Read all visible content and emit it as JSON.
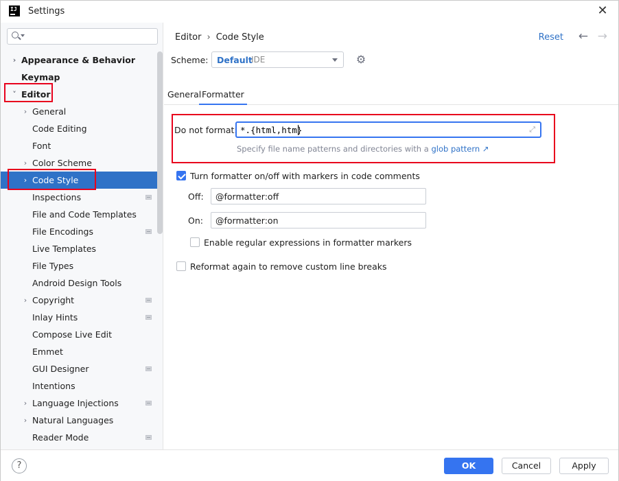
{
  "window": {
    "title": "Settings",
    "app_icon_text": "IJ"
  },
  "sidebar": {
    "search_placeholder": "",
    "items": [
      {
        "label": "Appearance & Behavior",
        "arrow": "›",
        "bold": true
      },
      {
        "label": "Keymap",
        "arrow": "",
        "bold": true
      },
      {
        "label": "Editor",
        "arrow": "˅",
        "bold": true
      },
      {
        "label": "General",
        "arrow": "›"
      },
      {
        "label": "Code Editing",
        "arrow": ""
      },
      {
        "label": "Font",
        "arrow": ""
      },
      {
        "label": "Color Scheme",
        "arrow": "›"
      },
      {
        "label": "Code Style",
        "arrow": "›",
        "selected": true
      },
      {
        "label": "Inspections",
        "arrow": "",
        "indicator": true
      },
      {
        "label": "File and Code Templates",
        "arrow": ""
      },
      {
        "label": "File Encodings",
        "arrow": "",
        "indicator": true
      },
      {
        "label": "Live Templates",
        "arrow": ""
      },
      {
        "label": "File Types",
        "arrow": ""
      },
      {
        "label": "Android Design Tools",
        "arrow": ""
      },
      {
        "label": "Copyright",
        "arrow": "›",
        "indicator": true
      },
      {
        "label": "Inlay Hints",
        "arrow": "",
        "indicator": true
      },
      {
        "label": "Compose Live Edit",
        "arrow": ""
      },
      {
        "label": "Emmet",
        "arrow": ""
      },
      {
        "label": "GUI Designer",
        "arrow": "",
        "indicator": true
      },
      {
        "label": "Intentions",
        "arrow": ""
      },
      {
        "label": "Language Injections",
        "arrow": "›",
        "indicator": true
      },
      {
        "label": "Natural Languages",
        "arrow": "›"
      },
      {
        "label": "Reader Mode",
        "arrow": "",
        "indicator": true
      }
    ]
  },
  "header": {
    "crumb_1": "Editor",
    "crumb_sep": "›",
    "crumb_2": "Code Style",
    "reset": "Reset",
    "back": "←",
    "forward": "→"
  },
  "scheme": {
    "label": "Scheme:",
    "value": "Default",
    "sub": "IDE",
    "gear": "⚙"
  },
  "tabs": [
    {
      "label": "General"
    },
    {
      "label": "Formatter",
      "active": true
    }
  ],
  "formatter": {
    "do_not_format_label": "Do not format:",
    "do_not_format_value": "*.{html,htm}",
    "expand_icon": "⤢",
    "hint_text": "Specify file name patterns and directories with a",
    "hint_link": "glob pattern ↗",
    "toggle_markers_label": "Turn formatter on/off with markers in code comments",
    "toggle_markers_checked": true,
    "off_label": "Off:",
    "off_value": "@formatter:off",
    "on_label": "On:",
    "on_value": "@formatter:on",
    "regex_label": "Enable regular expressions in formatter markers",
    "regex_checked": false,
    "reformat_label": "Reformat again to remove custom line breaks",
    "reformat_checked": false
  },
  "footer": {
    "help": "?",
    "ok": "OK",
    "cancel": "Cancel",
    "apply": "Apply"
  },
  "colors": {
    "accent": "#3574f0",
    "selection": "#2f72c7",
    "highlight_box": "#e8001c"
  }
}
